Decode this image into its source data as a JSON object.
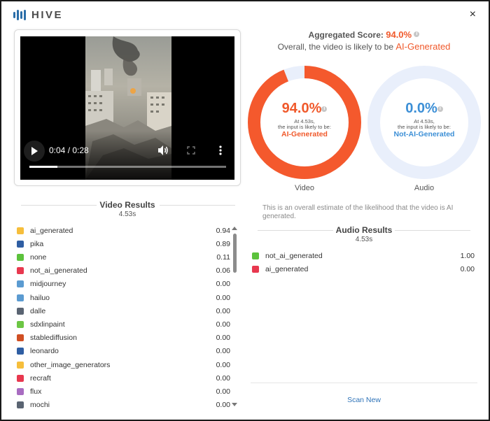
{
  "brand": {
    "name": "HIVE",
    "icon": "hive-bars-logo"
  },
  "close_label": "×",
  "player": {
    "time": "0:04 / 0:28",
    "progress": 0.143,
    "icons": [
      "play-icon",
      "volume-icon",
      "fullscreen-icon",
      "more-vert-icon"
    ]
  },
  "aggregated": {
    "label": "Aggregated Score:",
    "score": "94.0%",
    "line2_prefix": "Overall, the video is likely to be",
    "verdict": "AI-Generated"
  },
  "rings": {
    "video": {
      "pct": "94.0%",
      "fraction": 0.94,
      "at_text": "At 4.53s,",
      "likely_text": "the input is likely to be:",
      "verdict": "AI-Generated",
      "label": "Video",
      "color": "#f4592d"
    },
    "audio": {
      "pct": "0.0%",
      "fraction": 0.0,
      "at_text": "At 4.53s,",
      "likely_text": "the input is likely to be:",
      "verdict": "Not-AI-Generated",
      "label": "Audio",
      "color": "#3c8fd6"
    }
  },
  "estimate_note": "This is an overall estimate of the likelihood that the video is AI generated.",
  "video_results": {
    "title": "Video Results",
    "time": "4.53s",
    "items": [
      {
        "label": "ai_generated",
        "value": "0.94",
        "color": "#f6be3b"
      },
      {
        "label": "pika",
        "value": "0.89",
        "color": "#2f5ea3"
      },
      {
        "label": "none",
        "value": "0.11",
        "color": "#5cc23c"
      },
      {
        "label": "not_ai_generated",
        "value": "0.06",
        "color": "#e8384f"
      },
      {
        "label": "midjourney",
        "value": "0.00",
        "color": "#5b9bd1"
      },
      {
        "label": "hailuo",
        "value": "0.00",
        "color": "#5b9bd1"
      },
      {
        "label": "dalle",
        "value": "0.00",
        "color": "#5a6472"
      },
      {
        "label": "sdxlinpaint",
        "value": "0.00",
        "color": "#6cc644"
      },
      {
        "label": "stablediffusion",
        "value": "0.00",
        "color": "#d04f23"
      },
      {
        "label": "leonardo",
        "value": "0.00",
        "color": "#2f5ea3"
      },
      {
        "label": "other_image_generators",
        "value": "0.00",
        "color": "#f6be3b"
      },
      {
        "label": "recraft",
        "value": "0.00",
        "color": "#e8384f"
      },
      {
        "label": "flux",
        "value": "0.00",
        "color": "#a86cc1"
      },
      {
        "label": "mochi",
        "value": "0.00",
        "color": "#5a6472"
      }
    ]
  },
  "audio_results": {
    "title": "Audio Results",
    "time": "4.53s",
    "items": [
      {
        "label": "not_ai_generated",
        "value": "1.00",
        "color": "#5cc23c"
      },
      {
        "label": "ai_generated",
        "value": "0.00",
        "color": "#e8384f"
      }
    ]
  },
  "scan_new": "Scan New"
}
